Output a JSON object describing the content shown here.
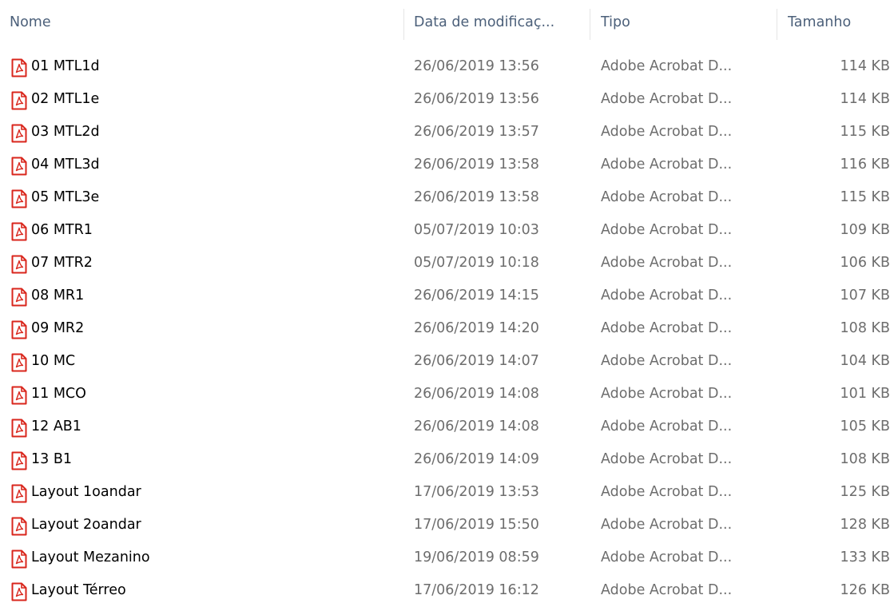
{
  "columns": {
    "name": "Nome",
    "date": "Data de modificaç...",
    "type": "Tipo",
    "size": "Tamanho"
  },
  "icon": "pdf-file-icon",
  "colors": {
    "icon_red": "#d9261c",
    "header_text": "#4c607a",
    "secondary_text": "#6d6d6d"
  },
  "files": [
    {
      "name": "01 MTL1d",
      "date": "26/06/2019 13:56",
      "type": "Adobe Acrobat D...",
      "size": "114 KB"
    },
    {
      "name": "02 MTL1e",
      "date": "26/06/2019 13:56",
      "type": "Adobe Acrobat D...",
      "size": "114 KB"
    },
    {
      "name": "03 MTL2d",
      "date": "26/06/2019 13:57",
      "type": "Adobe Acrobat D...",
      "size": "115 KB"
    },
    {
      "name": "04 MTL3d",
      "date": "26/06/2019 13:58",
      "type": "Adobe Acrobat D...",
      "size": "116 KB"
    },
    {
      "name": "05 MTL3e",
      "date": "26/06/2019 13:58",
      "type": "Adobe Acrobat D...",
      "size": "115 KB"
    },
    {
      "name": "06 MTR1",
      "date": "05/07/2019 10:03",
      "type": "Adobe Acrobat D...",
      "size": "109 KB"
    },
    {
      "name": "07 MTR2",
      "date": "05/07/2019 10:18",
      "type": "Adobe Acrobat D...",
      "size": "106 KB"
    },
    {
      "name": "08 MR1",
      "date": "26/06/2019 14:15",
      "type": "Adobe Acrobat D...",
      "size": "107 KB"
    },
    {
      "name": "09 MR2",
      "date": "26/06/2019 14:20",
      "type": "Adobe Acrobat D...",
      "size": "108 KB"
    },
    {
      "name": "10 MC",
      "date": "26/06/2019 14:07",
      "type": "Adobe Acrobat D...",
      "size": "104 KB"
    },
    {
      "name": "11 MCO",
      "date": "26/06/2019 14:08",
      "type": "Adobe Acrobat D...",
      "size": "101 KB"
    },
    {
      "name": "12 AB1",
      "date": "26/06/2019 14:08",
      "type": "Adobe Acrobat D...",
      "size": "105 KB"
    },
    {
      "name": "13 B1",
      "date": "26/06/2019 14:09",
      "type": "Adobe Acrobat D...",
      "size": "108 KB"
    },
    {
      "name": "Layout 1oandar",
      "date": "17/06/2019 13:53",
      "type": "Adobe Acrobat D...",
      "size": "125 KB"
    },
    {
      "name": "Layout 2oandar",
      "date": "17/06/2019 15:50",
      "type": "Adobe Acrobat D...",
      "size": "128 KB"
    },
    {
      "name": "Layout Mezanino",
      "date": "19/06/2019 08:59",
      "type": "Adobe Acrobat D...",
      "size": "133 KB"
    },
    {
      "name": "Layout Térreo",
      "date": "17/06/2019 16:12",
      "type": "Adobe Acrobat D...",
      "size": "126 KB"
    }
  ]
}
